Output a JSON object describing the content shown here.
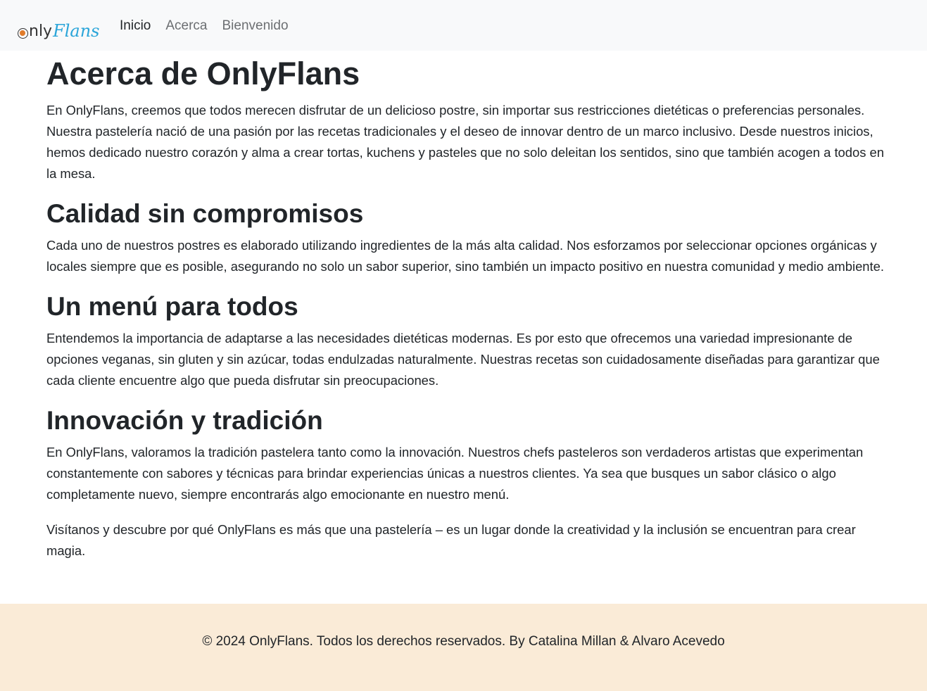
{
  "navbar": {
    "brand_only": "nly",
    "brand_flans": "Flans",
    "links": [
      {
        "label": "Inicio"
      },
      {
        "label": "Acerca"
      },
      {
        "label": "Bienvenido"
      }
    ]
  },
  "main": {
    "title": "Acerca de OnlyFlans",
    "intro": "En OnlyFlans, creemos que todos merecen disfrutar de un delicioso postre, sin importar sus restricciones dietéticas o preferencias personales. Nuestra pastelería nació de una pasión por las recetas tradicionales y el deseo de innovar dentro de un marco inclusivo. Desde nuestros inicios, hemos dedicado nuestro corazón y alma a crear tortas, kuchens y pasteles que no solo deleitan los sentidos, sino que también acogen a todos en la mesa.",
    "sections": [
      {
        "heading": "Calidad sin compromisos",
        "text": "Cada uno de nuestros postres es elaborado utilizando ingredientes de la más alta calidad. Nos esforzamos por seleccionar opciones orgánicas y locales siempre que es posible, asegurando no solo un sabor superior, sino también un impacto positivo en nuestra comunidad y medio ambiente."
      },
      {
        "heading": "Un menú para todos",
        "text": "Entendemos la importancia de adaptarse a las necesidades dietéticas modernas. Es por esto que ofrecemos una variedad impresionante de opciones veganas, sin gluten y sin azúcar, todas endulzadas naturalmente. Nuestras recetas son cuidadosamente diseñadas para garantizar que cada cliente encuentre algo que pueda disfrutar sin preocupaciones."
      },
      {
        "heading": "Innovación y tradición",
        "text": "En OnlyFlans, valoramos la tradición pastelera tanto como la innovación. Nuestros chefs pasteleros son verdaderos artistas que experimentan constantemente con sabores y técnicas para brindar experiencias únicas a nuestros clientes. Ya sea que busques un sabor clásico o algo completamente nuevo, siempre encontrarás algo emocionante en nuestro menú."
      }
    ],
    "closing": "Visítanos y descubre por qué OnlyFlans es más que una pastelería – es un lugar donde la creatividad y la inclusión se encuentran para crear magia."
  },
  "footer": {
    "text": "© 2024 OnlyFlans. Todos los derechos reservados. By Catalina Millan & Alvaro Acevedo"
  },
  "colors": {
    "navbar_bg": "#f8f9fa",
    "footer_bg": "#faebd7",
    "brand_accent": "#2aa5d9",
    "brand_dot": "#e07b2a",
    "text": "#212529"
  }
}
